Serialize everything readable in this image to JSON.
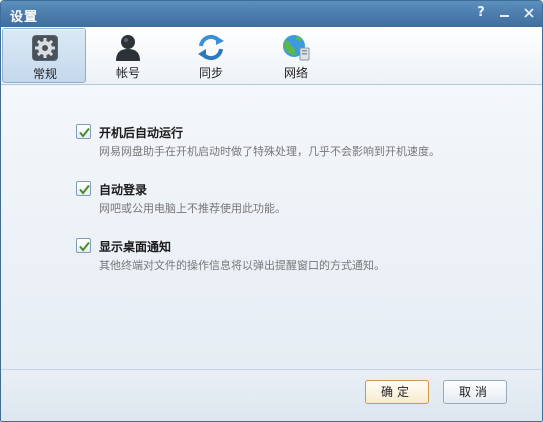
{
  "window": {
    "title": "设置"
  },
  "titlebar": {
    "help": "?",
    "minimize": "minimize",
    "close": "close"
  },
  "tabs": [
    {
      "label": "常规",
      "icon": "gear-icon",
      "active": true
    },
    {
      "label": "帐号",
      "icon": "user-icon",
      "active": false
    },
    {
      "label": "同步",
      "icon": "sync-icon",
      "active": false
    },
    {
      "label": "网络",
      "icon": "network-icon",
      "active": false
    }
  ],
  "options": [
    {
      "title": "开机后自动运行",
      "desc": "网易网盘助手在开机启动时做了特殊处理，几乎不会影响到开机速度。",
      "checked": true
    },
    {
      "title": "自动登录",
      "desc": "网吧或公用电脑上不推荐使用此功能。",
      "checked": true
    },
    {
      "title": "显示桌面通知",
      "desc": "其他终端对文件的操作信息将以弹出提醒窗口的方式通知。",
      "checked": true
    }
  ],
  "buttons": {
    "ok": "确定",
    "cancel": "取消"
  },
  "colors": {
    "titlebar": "#4a7bab",
    "accent": "#3f6d97",
    "check": "#4a8c2a"
  }
}
